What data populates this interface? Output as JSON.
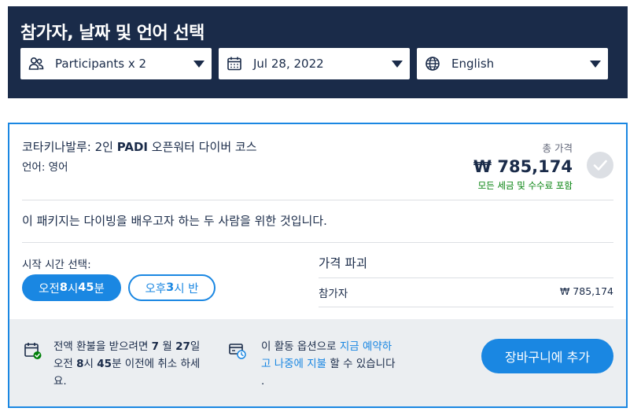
{
  "header": {
    "title": "참가자, 날짜 및 언어 선택",
    "participants": {
      "label": "Participants x 2",
      "icon": "people-icon"
    },
    "date": {
      "label": "Jul 28, 2022",
      "icon": "calendar-icon"
    },
    "language": {
      "label": "English",
      "icon": "globe-icon"
    }
  },
  "option": {
    "title_prefix": "코타키나발루: 2인 ",
    "title_bold": "PADI",
    "title_suffix": " 오픈워터 다이버 코스",
    "language": "언어: 영어",
    "total_label": "총 가격",
    "total_price": "₩ 785,174",
    "total_note": "모든 세금 및 수수료 포함",
    "description": "이 패키지는 다이빙을 배우고자 하는 두 사람을 위한 것입니다.",
    "start_time_label": "시작 시간 선택:",
    "times": [
      {
        "pre": "오전 ",
        "b1": "8",
        "mid": "시 ",
        "b2": "45",
        "post": "분"
      },
      {
        "pre": "오후 ",
        "b1": "3",
        "mid": "시 반",
        "b2": "",
        "post": ""
      }
    ],
    "breakdown_title": "가격 파괴",
    "breakdown_row_label": "참가자",
    "breakdown_row_value": "₩ 785,174"
  },
  "footer": {
    "refund_line1_pre": "전액 환불을 받으려면 ",
    "refund_line1_b1": "7",
    "refund_line1_mid": " 월 ",
    "refund_line1_b2": "27",
    "refund_line1_post": "일",
    "refund_line2_pre": "오전 ",
    "refund_line2_b1": "8",
    "refund_line2_mid": "시 ",
    "refund_line2_b2": "45",
    "refund_line2_post": "분 이전에 취소 하세",
    "refund_line3": "요.",
    "pay_line1_pre": "이 활동 옵션으로 ",
    "pay_line1_link": "지금 예약하",
    "pay_line2_link": "고 나중에 지불",
    "pay_line2_post": " 할 수 있습니다",
    "pay_line3": ".",
    "cart_button": "장바구니에 추가"
  },
  "colors": {
    "navy": "#1a2b49",
    "accent": "#1a87e2",
    "green": "#008009",
    "footer_bg": "#ebeef1"
  }
}
